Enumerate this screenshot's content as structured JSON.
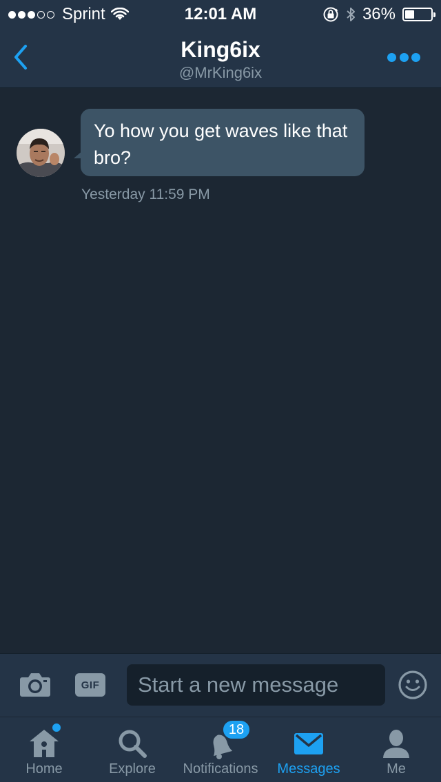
{
  "status_bar": {
    "signal_filled": 3,
    "signal_total": 5,
    "carrier": "Sprint",
    "time": "12:01 AM",
    "battery_percent_label": "36%",
    "battery_level": 0.36
  },
  "header": {
    "title": "King6ix",
    "subtitle": "@MrKing6ix",
    "back_icon": "chevron-left-icon",
    "more_icon": "more-dots-icon"
  },
  "conversation": {
    "messages": [
      {
        "text": "Yo how you get waves like that bro?",
        "timestamp": "Yesterday 11:59 PM"
      }
    ]
  },
  "composer": {
    "gif_label": "GIF",
    "placeholder": "Start a new message",
    "camera_icon": "camera-icon",
    "emoji_icon": "emoji-icon"
  },
  "tabs": [
    {
      "label": "Home",
      "icon": "home-icon",
      "has_dot": true
    },
    {
      "label": "Explore",
      "icon": "search-icon"
    },
    {
      "label": "Notifications",
      "icon": "bell-icon",
      "badge": "18"
    },
    {
      "label": "Messages",
      "icon": "envelope-icon",
      "active": true
    },
    {
      "label": "Me",
      "icon": "person-icon"
    }
  ],
  "colors": {
    "background": "#1c2733",
    "chrome": "#243447",
    "accent": "#1da1f2",
    "muted_text": "#8899a6",
    "bubble": "#3d5466"
  }
}
